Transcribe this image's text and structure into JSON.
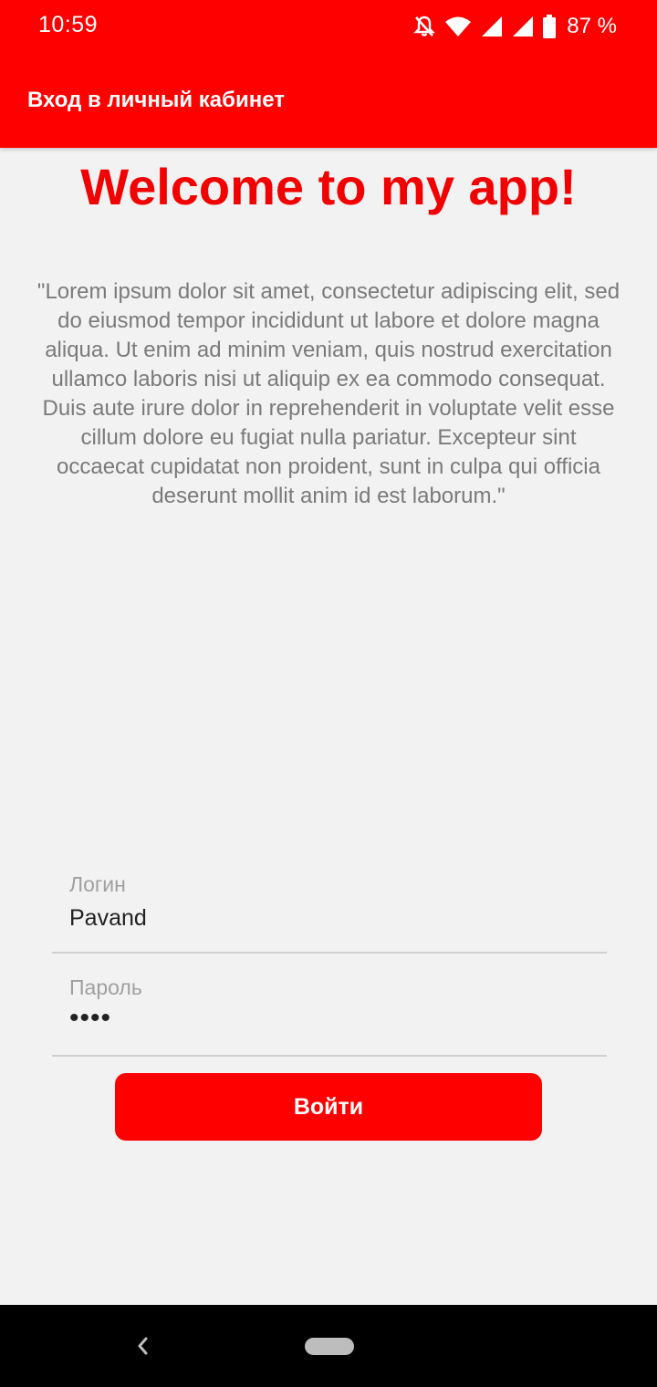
{
  "status_bar": {
    "time": "10:59",
    "battery_percent": "87 %",
    "icons": [
      "bell-off-icon",
      "wifi-icon",
      "signal-icon",
      "signal-icon",
      "battery-icon"
    ]
  },
  "app_bar": {
    "title": "Вход в личный кабинет"
  },
  "main": {
    "welcome_title": "Welcome to my app!",
    "lorem_text": "\"Lorem ipsum dolor sit amet, consectetur adipiscing elit, sed do eiusmod tempor incididunt ut labore et dolore magna aliqua. Ut enim ad minim veniam, quis nostrud exercitation ullamco laboris nisi ut aliquip ex ea commodo consequat. Duis aute irure dolor in reprehenderit in voluptate velit esse cillum dolore eu fugiat nulla pariatur. Excepteur sint occaecat cupidatat non proident, sunt in culpa qui officia deserunt mollit anim id est laborum.\""
  },
  "form": {
    "login_label": "Логин",
    "login_value": "Pavand",
    "password_label": "Пароль",
    "password_value": "••••",
    "submit_label": "Войти"
  },
  "colors": {
    "accent": "#ff0000",
    "background": "#f2f2f2",
    "nav_bar": "#000000"
  }
}
